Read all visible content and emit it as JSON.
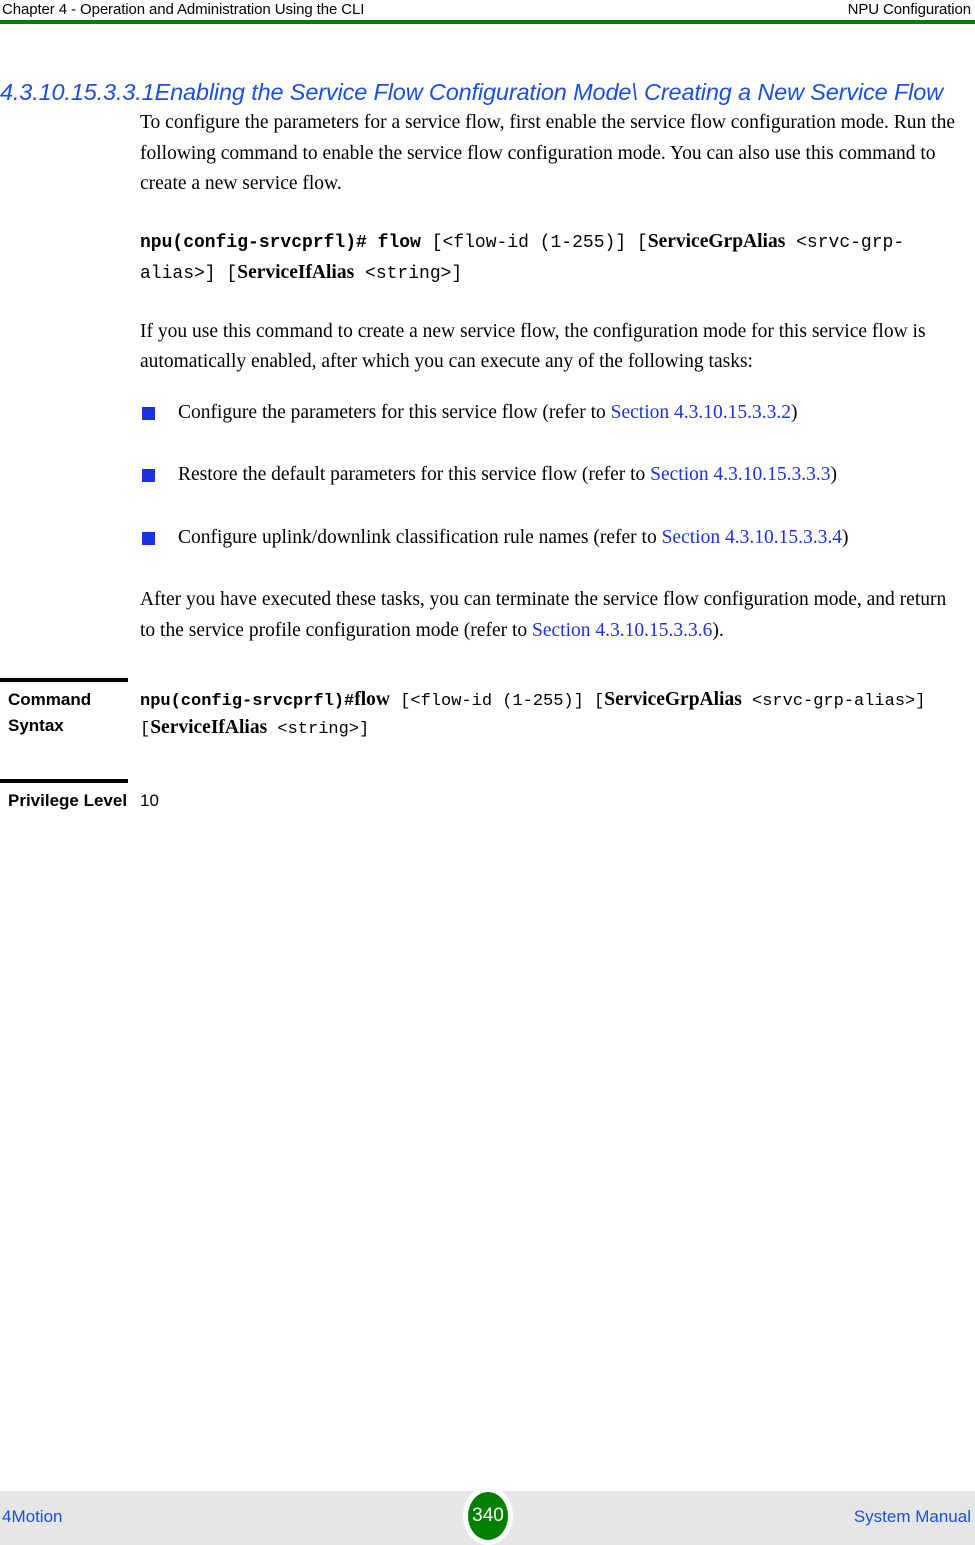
{
  "header": {
    "left": "Chapter 4 - Operation and Administration Using the CLI",
    "right": "NPU Configuration",
    "rule_color": "#008000"
  },
  "section": {
    "number": "4.3.10.15.3.3.1",
    "title": "Enabling the Service Flow Configuration Mode\\ Creating a New Service Flow",
    "color": "#1a4fe0"
  },
  "paragraphs": {
    "intro": "To configure the parameters for a service flow, first enable the service flow configuration mode. Run the following command to enable the service flow configuration mode. You can also use this command to create a new service flow.",
    "after_command": "If you use this command to create a new service flow, the configuration mode for this service flow is automatically enabled, after which you can execute any of the following tasks:",
    "closing_pre": "After you have executed these tasks, you can terminate the service flow configuration mode, and return to the service profile configuration mode (refer to ",
    "closing_link": "Section 4.3.10.15.3.3.6",
    "closing_post": ")."
  },
  "command_inline": {
    "prompt": "npu(config-srvcprfl)#",
    "keyword": "flow",
    "arg1": "[<flow-id (1-255)] [",
    "param1": "ServiceGrpAlias",
    "arg2": "<srvc-grp-alias>] [",
    "param2": "ServiceIfAlias",
    "arg3": "<string>]"
  },
  "bullets": [
    {
      "text_pre": "Configure the parameters for this service flow (refer to ",
      "link": "Section 4.3.10.15.3.3.2",
      "text_post": ")",
      "marker_color": "#1a33e0"
    },
    {
      "text_pre": "Restore the default parameters for this service flow (refer to ",
      "link": "Section 4.3.10.15.3.3.3",
      "text_post": ")",
      "marker_color": "#1a33e0"
    },
    {
      "text_pre": "Configure uplink/downlink classification rule names (refer to ",
      "link": "Section 4.3.10.15.3.3.4",
      "text_post": ")",
      "marker_color": "#1a33e0"
    }
  ],
  "command_table": {
    "rows": [
      {
        "label": "Command Syntax",
        "type": "syntax"
      },
      {
        "label": "Privilege Level",
        "value": "10",
        "type": "plain"
      }
    ],
    "syntax": {
      "prompt": "npu(config-srvcprfl)#",
      "keyword": "flow",
      "arg1": " [<flow-id (1-255)] [",
      "param1": "ServiceGrpAlias",
      "arg2": "<srvc-grp-alias>] [",
      "param2": "ServiceIfAlias",
      "arg3": "<string>]"
    }
  },
  "footer": {
    "left": "4Motion",
    "page_number": "340",
    "right": "System Manual",
    "badge_color": "#008000",
    "background": "#e6e6e6"
  }
}
